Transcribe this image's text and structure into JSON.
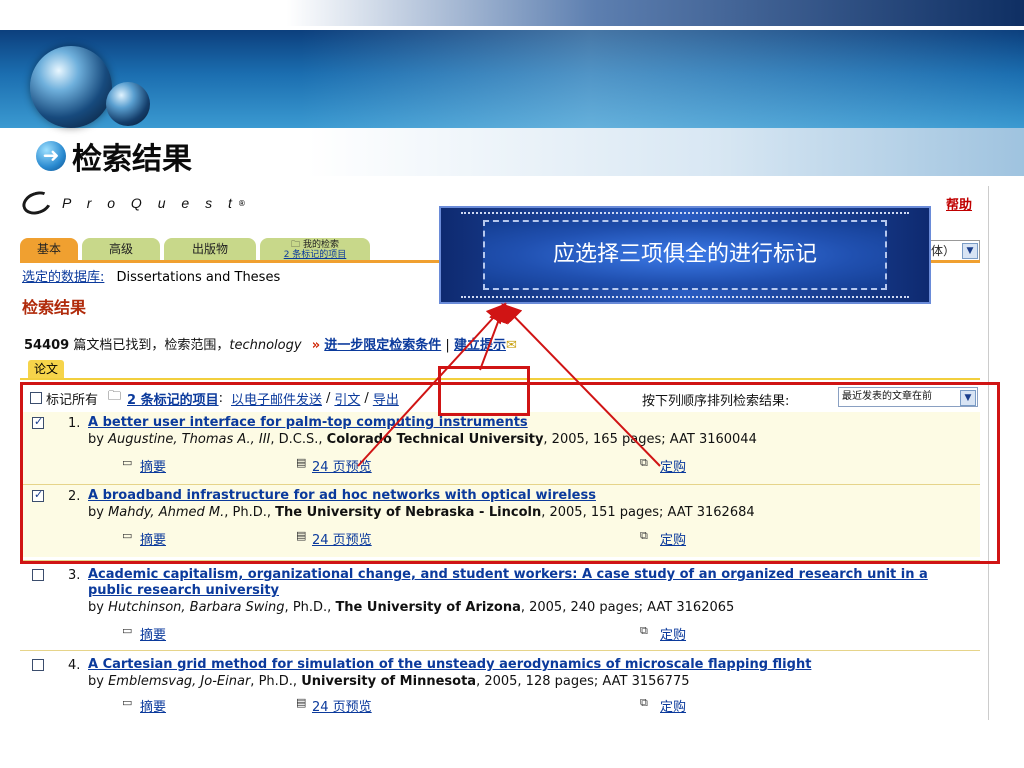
{
  "slide": {
    "title": "检索结果",
    "title_icon": "arrow-right-circle-icon"
  },
  "proquest": {
    "logo_text": "P r o Q u e s t",
    "reg_mark": "®",
    "help": "帮助"
  },
  "tabs": [
    {
      "label": "基本"
    },
    {
      "label": "高级"
    },
    {
      "label": "出版物"
    },
    {
      "label_top": "我的检索",
      "label_bottom": "2 条标记的项目"
    }
  ],
  "db_select": {
    "text": "体）",
    "arrow": "▼"
  },
  "database": {
    "label": "选定的数据库:",
    "value": "Dissertations and Theses"
  },
  "heading": "检索结果",
  "count": {
    "num": "54409",
    "text1": " 篇文档已找到，检索范围，",
    "term": "technology",
    "arrow": "»",
    "refine": "进一步限定检索条件",
    "bar": "|",
    "alert": "建立提示"
  },
  "tag": "论文",
  "toolbar": {
    "mark_all": "标记所有",
    "marked": "2 条标记的项目",
    "email": "以电子邮件发送",
    "cite": "引文",
    "export": "导出",
    "sort_label": "按下列顺序排列检索结果:",
    "sort_value": "最近发表的文章在前"
  },
  "results": [
    {
      "num": "1.",
      "title": "A better user interface for palm-top computing instruments",
      "author": "Augustine, Thomas A., III",
      "degree": "D.C.S.",
      "school": "Colorado Technical University",
      "rest": ", 2005, 165 pages; AAT 3160044",
      "abstract": "摘要",
      "preview": "24 页预览",
      "order": "定购",
      "checked": true
    },
    {
      "num": "2.",
      "title": "A broadband infrastructure for ad hoc networks with optical wireless",
      "author": "Mahdy, Ahmed M.",
      "degree": "Ph.D.",
      "school": "The University of Nebraska - Lincoln",
      "rest": ", 2005, 151 pages; AAT 3162684",
      "abstract": "摘要",
      "preview": "24 页预览",
      "order": "定购",
      "checked": true
    },
    {
      "num": "3.",
      "title": "Academic capitalism, organizational change, and student workers: A case study of an organized research unit in a public research university",
      "author": "Hutchinson, Barbara Swing",
      "degree": "Ph.D.",
      "school": "The University of Arizona",
      "rest": ", 2005, 240 pages; AAT 3162065",
      "abstract": "摘要",
      "preview": "",
      "order": "定购",
      "checked": false
    },
    {
      "num": "4.",
      "title": "A Cartesian grid method for simulation of the unsteady aerodynamics of microscale flapping flight",
      "author": "Emblemsvag, Jo-Einar",
      "degree": "Ph.D.",
      "school": "University of Minnesota",
      "rest": ", 2005, 128 pages; AAT 3156775",
      "abstract": "摘要",
      "preview": "24 页预览",
      "order": "定购",
      "checked": false
    }
  ],
  "callout": {
    "text": "应选择三项俱全的进行标记"
  },
  "colors": {
    "annotation_red": "#d01414",
    "link_blue": "#0b3a9c",
    "tab_orange": "#f0a030",
    "tab_green": "#c8d88a"
  }
}
